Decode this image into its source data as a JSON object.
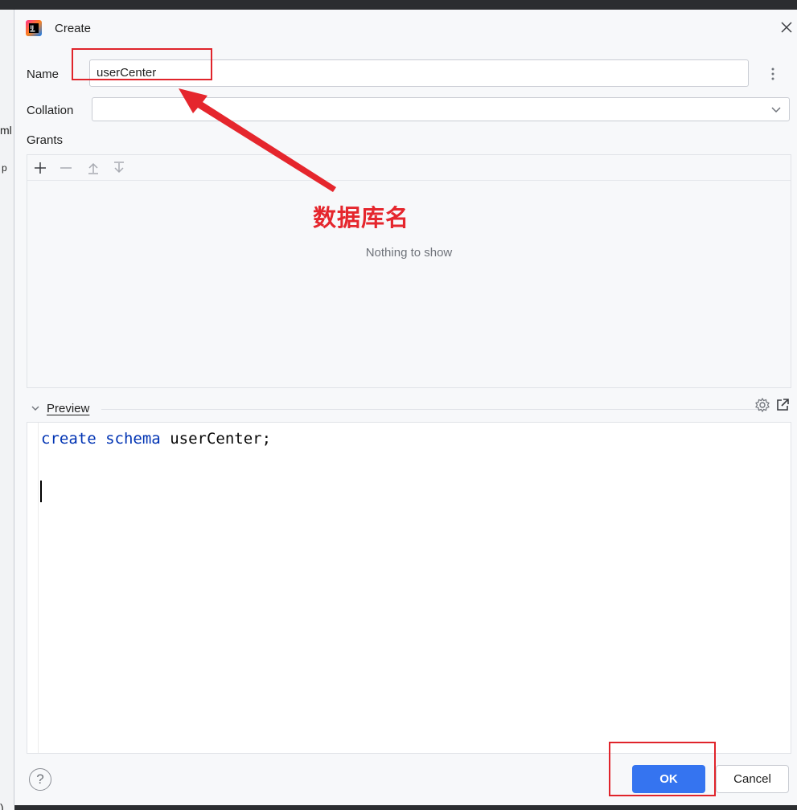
{
  "dialog": {
    "title": "Create",
    "name_label": "Name",
    "name_value": "userCenter",
    "collation_label": "Collation",
    "collation_value": "",
    "grants_label": "Grants",
    "grants_empty": "Nothing to show",
    "preview_label": "Preview",
    "code": {
      "kw1": "create",
      "kw2": "schema",
      "ident": "userCenter;"
    },
    "help_label": "?",
    "ok_label": "OK",
    "cancel_label": "Cancel"
  },
  "background": {
    "left_text_1": "ml",
    "left_text_2": "p",
    "left_text_3": ")"
  },
  "annotation": {
    "text": "数据库名"
  },
  "colors": {
    "accent": "#3574f0",
    "annotation_red": "#e5262d",
    "keyword_blue": "#0033b3"
  },
  "icons": [
    "jetbrains-app-icon",
    "close-icon",
    "kebab-icon",
    "chevron-down-icon",
    "plus-icon",
    "minus-icon",
    "move-up-icon",
    "move-down-icon",
    "gear-icon",
    "popout-icon",
    "help-icon"
  ]
}
